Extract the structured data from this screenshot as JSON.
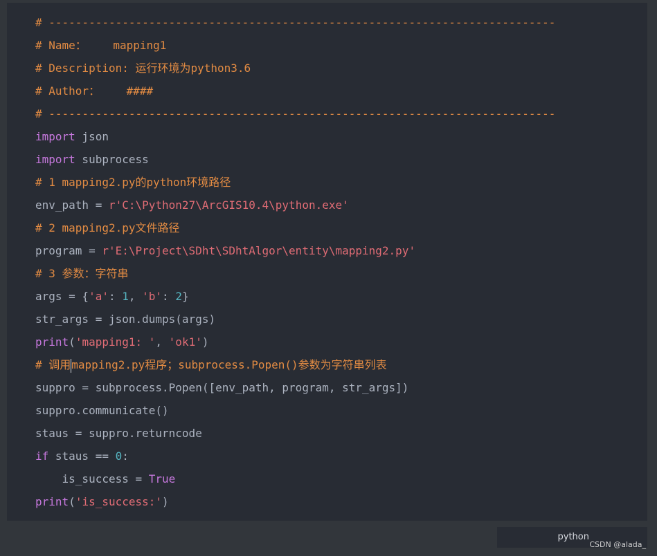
{
  "code_block": {
    "language": "python",
    "lines": [
      [
        {
          "t": "com",
          "s": "# ----------------------------------------------------------------------------"
        }
      ],
      [
        {
          "t": "com",
          "s": "# Name：    mapping1"
        }
      ],
      [
        {
          "t": "com",
          "s": "# Description: 运行环境为python3.6"
        }
      ],
      [
        {
          "t": "com",
          "s": "# Author：    ####"
        }
      ],
      [
        {
          "t": "com",
          "s": "# ----------------------------------------------------------------------------"
        }
      ],
      [
        {
          "t": "kw",
          "s": "import"
        },
        {
          "t": "def",
          "s": " json"
        }
      ],
      [
        {
          "t": "kw",
          "s": "import"
        },
        {
          "t": "def",
          "s": " subprocess"
        }
      ],
      [
        {
          "t": "com",
          "s": "# 1 mapping2.py的python环境路径"
        }
      ],
      [
        {
          "t": "def",
          "s": "env_path = "
        },
        {
          "t": "str",
          "s": "r'C:\\Python27\\ArcGIS10.4\\python.exe'"
        }
      ],
      [
        {
          "t": "com",
          "s": "# 2 mapping2.py文件路径"
        }
      ],
      [
        {
          "t": "def",
          "s": "program = "
        },
        {
          "t": "str",
          "s": "r'E:\\Project\\SDht\\SDhtAlgor\\entity\\mapping2.py'"
        }
      ],
      [
        {
          "t": "com",
          "s": "# 3 参数：字符串"
        }
      ],
      [
        {
          "t": "def",
          "s": "args = {"
        },
        {
          "t": "str",
          "s": "'a'"
        },
        {
          "t": "def",
          "s": ": "
        },
        {
          "t": "num",
          "s": "1"
        },
        {
          "t": "def",
          "s": ", "
        },
        {
          "t": "str",
          "s": "'b'"
        },
        {
          "t": "def",
          "s": ": "
        },
        {
          "t": "num",
          "s": "2"
        },
        {
          "t": "def",
          "s": "}"
        }
      ],
      [
        {
          "t": "def",
          "s": "str_args = json.dumps(args)"
        }
      ],
      [
        {
          "t": "bi",
          "s": "print"
        },
        {
          "t": "def",
          "s": "("
        },
        {
          "t": "str",
          "s": "'mapping1: '"
        },
        {
          "t": "def",
          "s": ", "
        },
        {
          "t": "str",
          "s": "'ok1'"
        },
        {
          "t": "def",
          "s": ")"
        }
      ],
      [
        {
          "t": "com",
          "s": "# 调用"
        },
        {
          "t": "caret",
          "s": ""
        },
        {
          "t": "com",
          "s": "mapping2.py程序；subprocess.Popen()参数为字符串列表"
        }
      ],
      [
        {
          "t": "def",
          "s": "suppro = subprocess.Popen([env_path, program, str_args])"
        }
      ],
      [
        {
          "t": "def",
          "s": "suppro.communicate()"
        }
      ],
      [
        {
          "t": "def",
          "s": "staus = suppro.returncode"
        }
      ],
      [
        {
          "t": "kw",
          "s": "if"
        },
        {
          "t": "def",
          "s": " staus == "
        },
        {
          "t": "num",
          "s": "0"
        },
        {
          "t": "def",
          "s": ":"
        }
      ],
      [
        {
          "t": "def",
          "s": "    is_success = "
        },
        {
          "t": "kw",
          "s": "True"
        }
      ],
      [
        {
          "t": "bi",
          "s": "print"
        },
        {
          "t": "def",
          "s": "("
        },
        {
          "t": "str",
          "s": "'is_success:'"
        },
        {
          "t": "def",
          "s": ")"
        }
      ]
    ]
  },
  "language_label": "python",
  "watermark": "CSDN @alada_",
  "colors": {
    "page_bg": "#32363b",
    "code_bg": "#282c34",
    "comment": "#e28b43",
    "keyword": "#c678dd",
    "string": "#e06c75",
    "number": "#56b6c2",
    "default": "#abb2bf"
  }
}
